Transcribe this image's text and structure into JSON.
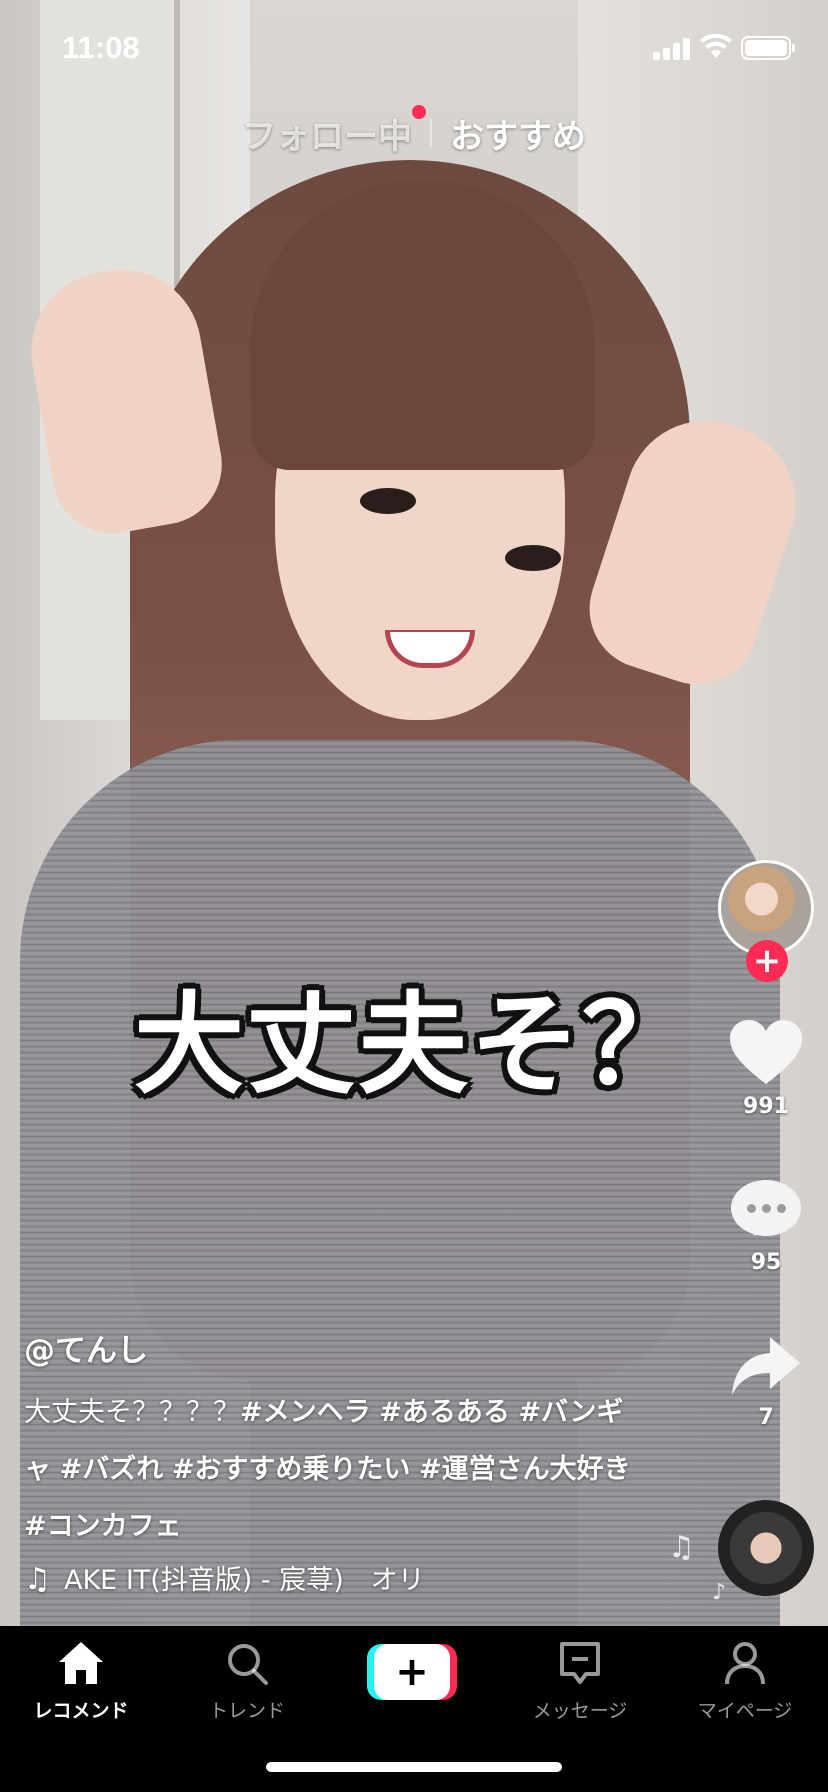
{
  "status_bar": {
    "time": "11:08"
  },
  "top_tabs": {
    "following": "フォロー中",
    "for_you": "おすすめ"
  },
  "video": {
    "caption_overlay": "大丈夫そ？"
  },
  "actions": {
    "likes": "991",
    "comments": "95",
    "shares": "7"
  },
  "post": {
    "username": "@てんし",
    "description_plain": "大丈夫そ？？？？",
    "hashtags": [
      "#メンヘラ",
      "#あるある",
      "#バンギャ",
      "#バズれ",
      "#おすすめ乗りたい",
      "#運営さん大好き",
      "#コンカフェ"
    ],
    "music": "AKE IT(抖音版) - 宸荨)　オリ"
  },
  "bottom_nav": {
    "items": [
      {
        "label": "レコメンド",
        "icon": "home-icon",
        "active": true
      },
      {
        "label": "トレンド",
        "icon": "search-icon",
        "active": false
      },
      {
        "label": "+",
        "icon": "create-icon",
        "active": false
      },
      {
        "label": "メッセージ",
        "icon": "inbox-icon",
        "active": false
      },
      {
        "label": "マイページ",
        "icon": "profile-icon",
        "active": false
      }
    ]
  },
  "colors": {
    "accent": "#fe2c55",
    "cyan": "#25f4ee",
    "nav_bg": "#000000"
  }
}
